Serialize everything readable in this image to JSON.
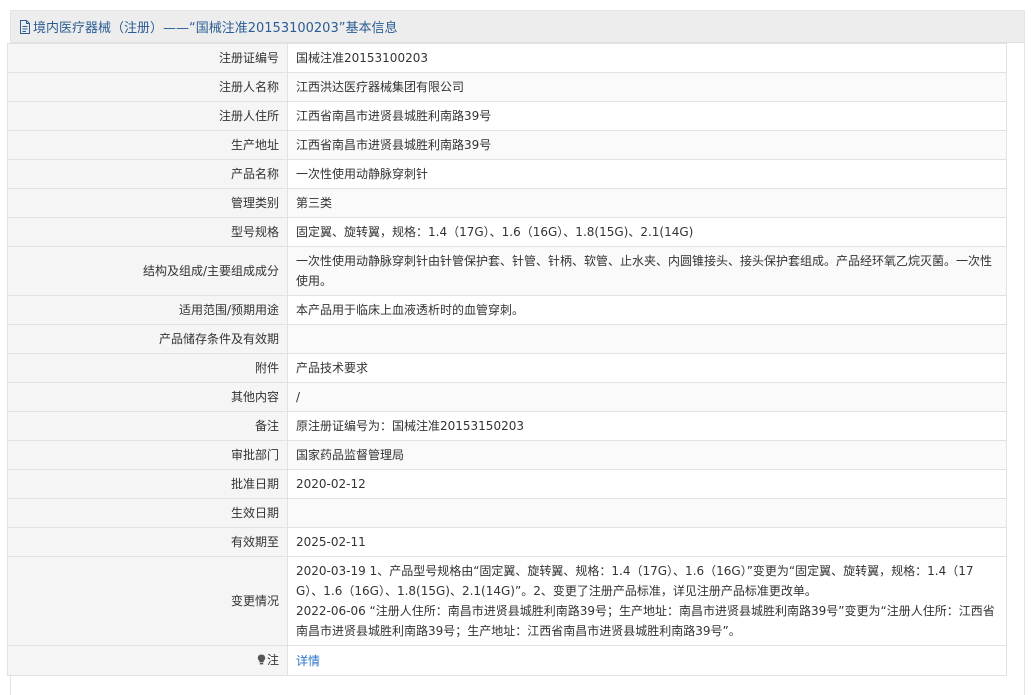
{
  "header": {
    "title": "境内医疗器械（注册）——“国械注准20153100203”基本信息"
  },
  "rows": [
    {
      "label": "注册证编号",
      "value": "国械注准20153100203"
    },
    {
      "label": "注册人名称",
      "value": "江西洪达医疗器械集团有限公司"
    },
    {
      "label": "注册人住所",
      "value": "江西省南昌市进贤县城胜利南路39号"
    },
    {
      "label": "生产地址",
      "value": "江西省南昌市进贤县城胜利南路39号"
    },
    {
      "label": "产品名称",
      "value": "一次性使用动静脉穿刺针"
    },
    {
      "label": "管理类别",
      "value": "第三类"
    },
    {
      "label": "型号规格",
      "value": "固定翼、旋转翼，规格：1.4（17G）、1.6（16G）、1.8(15G)、2.1(14G)"
    },
    {
      "label": "结构及组成/主要组成成分",
      "value": "一次性使用动静脉穿刺针由针管保护套、针管、针柄、软管、止水夹、内圆锥接头、接头保护套组成。产品经环氧乙烷灭菌。一次性使用。"
    },
    {
      "label": "适用范围/预期用途",
      "value": "本产品用于临床上血液透析时的血管穿刺。"
    },
    {
      "label": "产品储存条件及有效期",
      "value": ""
    },
    {
      "label": "附件",
      "value": "产品技术要求"
    },
    {
      "label": "其他内容",
      "value": "/"
    },
    {
      "label": "备注",
      "value": "原注册证编号为：国械注准20153150203"
    },
    {
      "label": "审批部门",
      "value": "国家药品监督管理局"
    },
    {
      "label": "批准日期",
      "value": "2020-02-12"
    },
    {
      "label": "生效日期",
      "value": ""
    },
    {
      "label": "有效期至",
      "value": "2025-02-11"
    }
  ],
  "changes": {
    "label": "变更情况",
    "entries": [
      "2020-03-19 1、产品型号规格由“固定翼、旋转翼、规格：1.4（17G）、1.6（16G）”变更为“固定翼、旋转翼，规格：1.4（17G）、1.6（16G）、1.8(15G)、2.1(14G)”。2、变更了注册产品标准，详见注册产品标准更改单。",
      "2022-06-06 “注册人住所：南昌市进贤县城胜利南路39号；生产地址：南昌市进贤县城胜利南路39号”变更为“注册人住所：江西省南昌市进贤县城胜利南路39号；生产地址：江西省南昌市进贤县城胜利南路39号”。"
    ]
  },
  "note": {
    "label": "注",
    "link_text": "详情"
  },
  "colors": {
    "title_text": "#2b5c94",
    "link": "#2b74c8"
  },
  "icons": {
    "title": "document-icon",
    "note": "lightbulb-icon"
  }
}
